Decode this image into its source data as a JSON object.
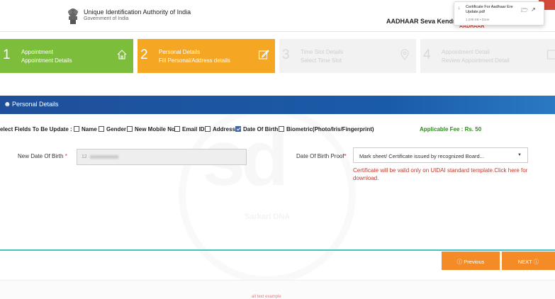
{
  "header": {
    "org_name": "Unique Identification Authority of India",
    "org_sub": "Government of India",
    "brand": "AADHAAR Seva Kendras",
    "brand_red": "AADHAAR"
  },
  "download": {
    "file_name": "Certificate For Aadhaar Ere Update.pdf",
    "meta": "1,038 KB • Done"
  },
  "steps": [
    {
      "num": "1",
      "title": "Appointment",
      "sub": "Appointment Details",
      "icon": "home-icon",
      "state": "done"
    },
    {
      "num": "2",
      "title": "Personal Details",
      "sub": "Fill Personal/Address details",
      "icon": "edit-icon",
      "state": "active"
    },
    {
      "num": "3",
      "title": "Time Slot Details",
      "sub": "Select Time Slot",
      "icon": "location-icon",
      "state": "pending"
    },
    {
      "num": "4",
      "title": "Appointment Detail",
      "sub": "Review Appointment Detail",
      "icon": "check-icon",
      "state": "pending"
    }
  ],
  "section": {
    "title": "Personal Details"
  },
  "fields": {
    "prefix": "elect Fields To Be Update :",
    "options": [
      {
        "label": "Name",
        "checked": false
      },
      {
        "label": "Gender",
        "checked": false
      },
      {
        "label": "New Mobile No",
        "checked": false
      },
      {
        "label": "Email ID",
        "checked": false
      },
      {
        "label": "Address",
        "checked": false
      },
      {
        "label": "Date Of Birth",
        "checked": true
      },
      {
        "label": "Biometric(Photo/Iris/Fingerprint)",
        "checked": false
      }
    ],
    "fee": "Applicable Fee : Rs. 50"
  },
  "form": {
    "dob_label": "New Date Of Birth",
    "dob_value": "12",
    "proof_label": "Date Of Birth Proof",
    "proof_value": "Mark sheet/ Certificate issued by recognized Board...",
    "warning": "Certificate will be valid only on UIDAI standard template.Click here for download."
  },
  "buttons": {
    "previous": "Previous",
    "next": "NEXT"
  },
  "bottom_text": "all text example",
  "watermark": {
    "letters": "sd",
    "label": "Sarkari DNA"
  },
  "colors": {
    "step_done": "#7cbe3b",
    "step_active": "#f5a623",
    "section_bar": "#1a5ba8",
    "fee_green": "#2e8b1e",
    "warning_red": "#c0392b",
    "button_orange": "#f58b26",
    "divider_teal": "#45c2c2"
  }
}
